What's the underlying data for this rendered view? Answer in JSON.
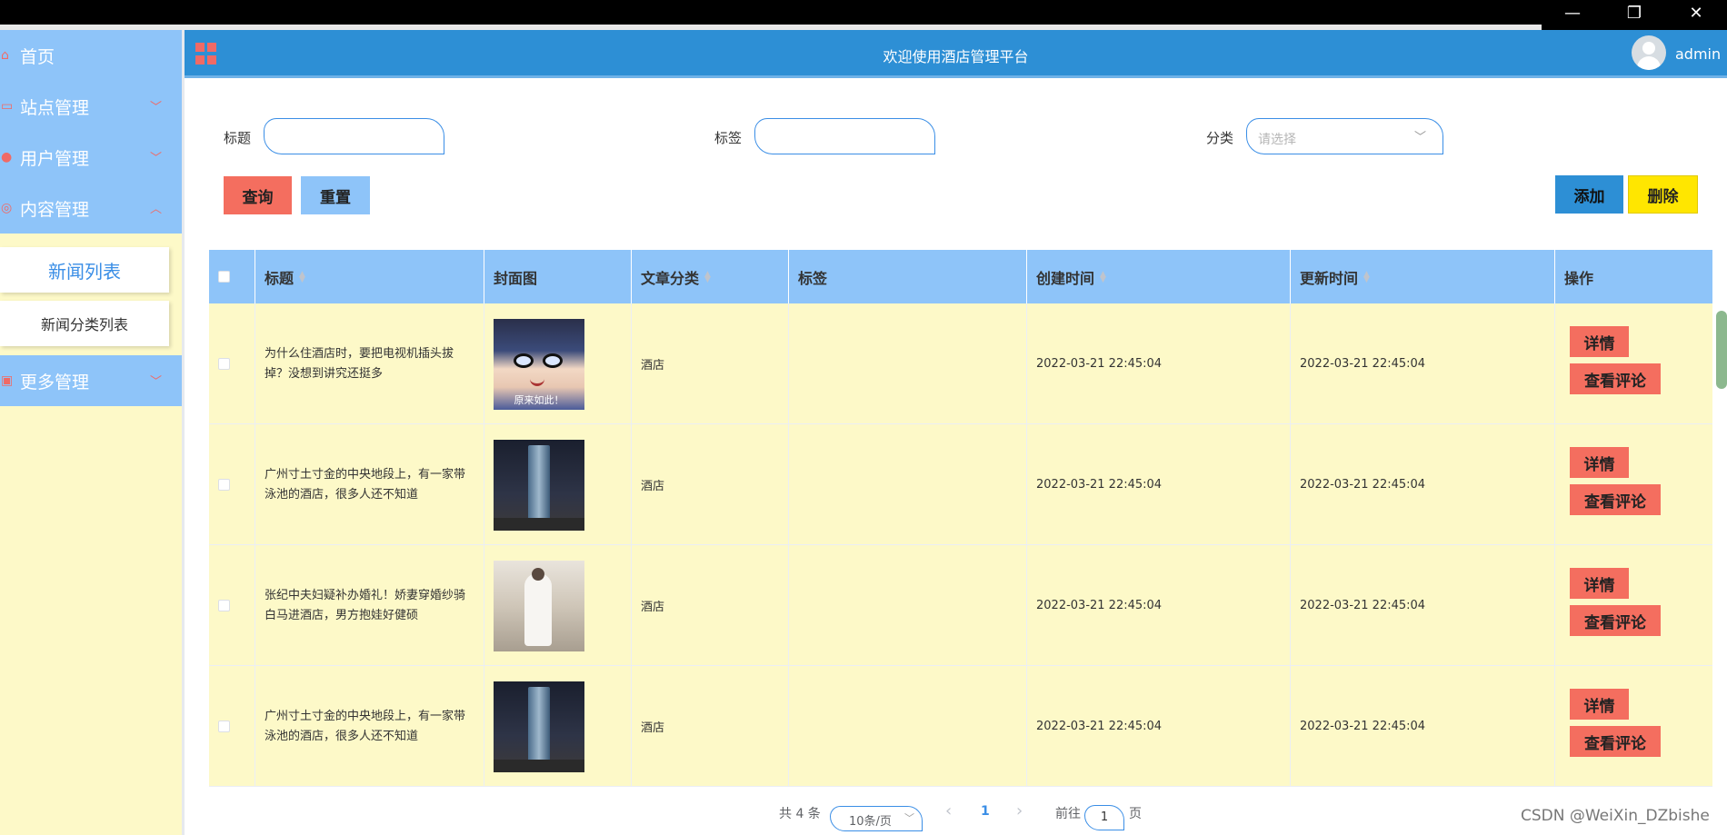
{
  "window": {
    "minimize": "—",
    "restore": "❐",
    "close": "✕"
  },
  "sidebar": {
    "items": [
      {
        "label": "首页",
        "icon": "home-icon",
        "glyph": "⌂"
      },
      {
        "label": "站点管理",
        "icon": "monitor-icon",
        "glyph": "▭"
      },
      {
        "label": "用户管理",
        "icon": "user-icon",
        "glyph": "●"
      },
      {
        "label": "内容管理",
        "icon": "content-icon",
        "glyph": "◎"
      },
      {
        "label": "更多管理",
        "icon": "more-icon",
        "glyph": "▣"
      }
    ],
    "sub_items": [
      {
        "label": "新闻列表",
        "active": true
      },
      {
        "label": "新闻分类列表",
        "active": false
      }
    ],
    "chevron_down": "﹀",
    "chevron_up": "︿"
  },
  "header": {
    "title": "欢迎使用酒店管理平台",
    "username": "admin"
  },
  "filters": {
    "title_label": "标题",
    "title_value": "",
    "tag_label": "标签",
    "tag_value": "",
    "category_label": "分类",
    "category_placeholder": "请选择"
  },
  "buttons": {
    "query": "查询",
    "reset": "重置",
    "add": "添加",
    "delete": "删除"
  },
  "table": {
    "columns": [
      "标题",
      "封面图",
      "文章分类",
      "标签",
      "创建时间",
      "更新时间",
      "操作"
    ],
    "rows": [
      {
        "title": "为什么住酒店时，要把电视机插头拔掉？没想到讲究还挺多",
        "cover_caption": "原来如此！",
        "category": "酒店",
        "tags": "",
        "created": "2022-03-21 22:45:04",
        "updated": "2022-03-21 22:45:04",
        "detail": "详情",
        "comments": "查看评论"
      },
      {
        "title": "广州寸土寸金的中央地段上，有一家带泳池的酒店，很多人还不知道",
        "cover_caption": "",
        "category": "酒店",
        "tags": "",
        "created": "2022-03-21 22:45:04",
        "updated": "2022-03-21 22:45:04",
        "detail": "详情",
        "comments": "查看评论"
      },
      {
        "title": "张纪中夫妇疑补办婚礼！娇妻穿婚纱骑白马进酒店，男方抱娃好健硕",
        "cover_caption": "",
        "category": "酒店",
        "tags": "",
        "created": "2022-03-21 22:45:04",
        "updated": "2022-03-21 22:45:04",
        "detail": "详情",
        "comments": "查看评论"
      },
      {
        "title": "广州寸土寸金的中央地段上，有一家带泳池的酒店，很多人还不知道",
        "cover_caption": "",
        "category": "酒店",
        "tags": "",
        "created": "2022-03-21 22:45:04",
        "updated": "2022-03-21 22:45:04",
        "detail": "详情",
        "comments": "查看评论"
      }
    ]
  },
  "pagination": {
    "total": "共 4 条",
    "page_size": "10条/页",
    "prev": "‹",
    "current": "1",
    "next": "›",
    "goto_label": "前往",
    "goto_value": "1",
    "goto_suffix": "页"
  },
  "watermark": "CSDN @WeiXin_DZbishe",
  "colors": {
    "sidebar": "#8ec4f9",
    "header": "#2d8fd5",
    "accent": "#f06a66",
    "row_bg": "#fdf9c8",
    "delete": "#ffe600",
    "add": "#2d8fd5"
  }
}
